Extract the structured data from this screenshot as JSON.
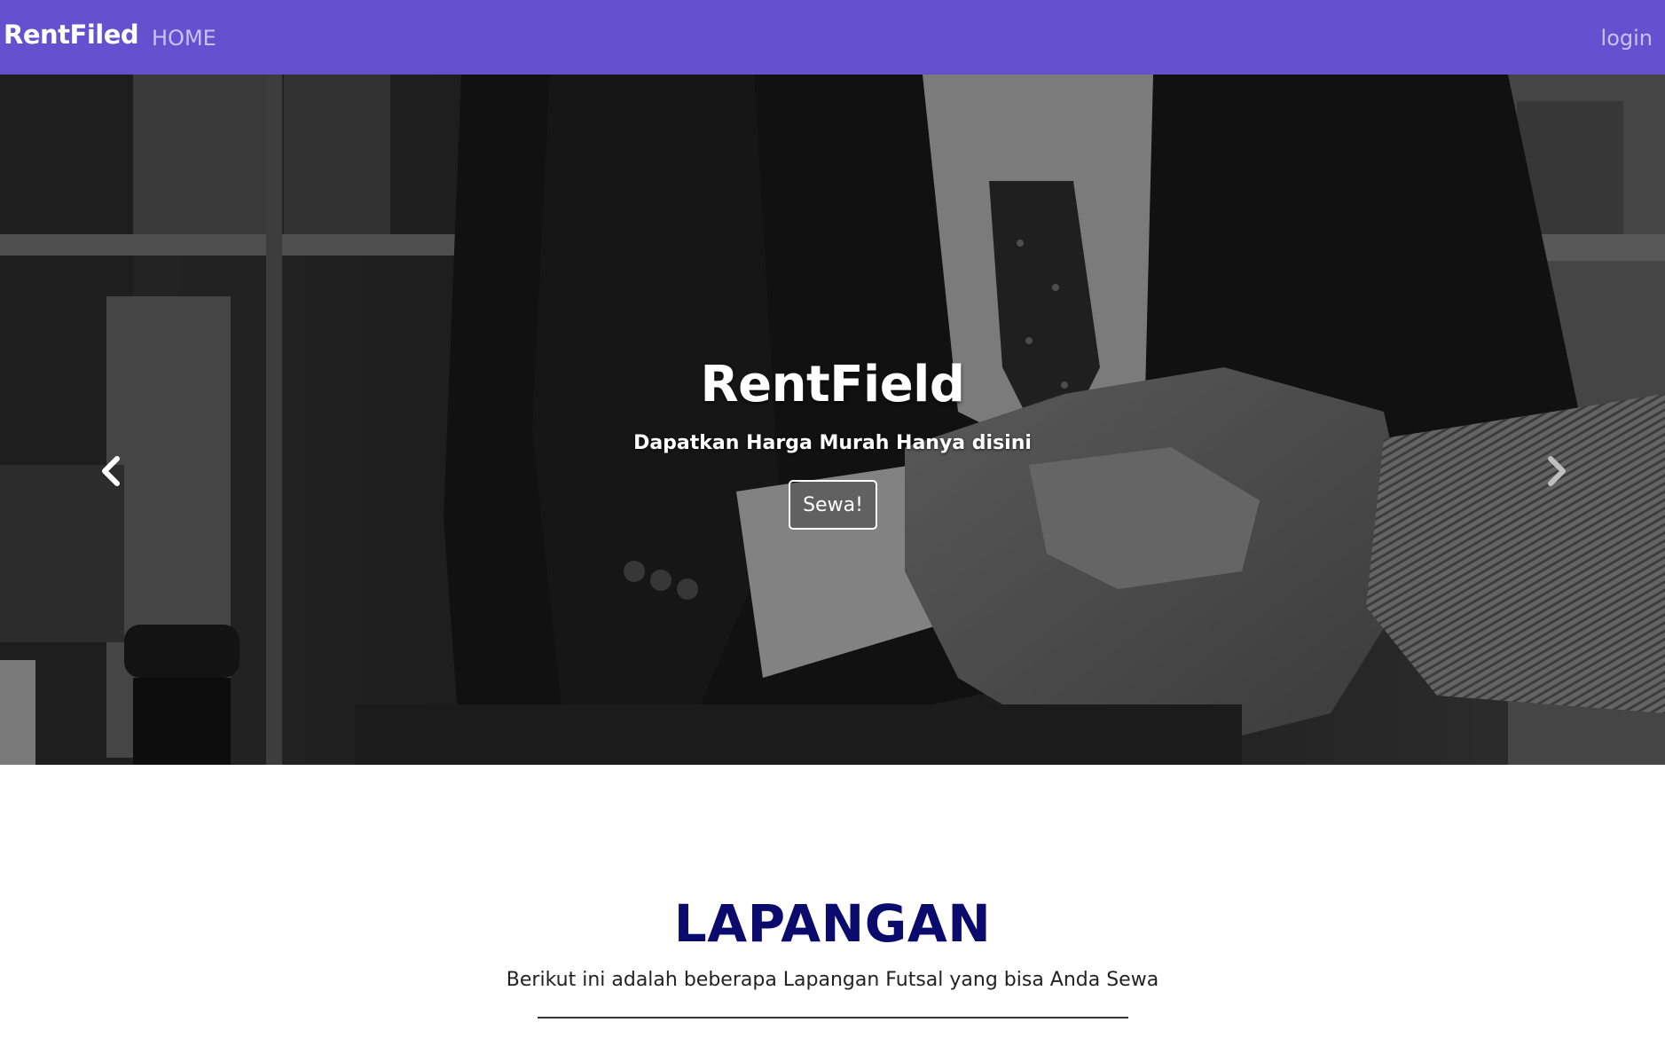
{
  "navbar": {
    "brand": "RentFiled",
    "home": "HOME",
    "login": "login",
    "background": "#6551cf"
  },
  "hero": {
    "title": "RentField",
    "subtitle": "Dapatkan Harga Murah Hanya disini",
    "button": "Sewa!",
    "image": "handshake-photo"
  },
  "section": {
    "title": "LAPANGAN",
    "subtitle": "Berikut ini adalah beberapa Lapangan Futsal yang bisa Anda Sewa",
    "title_color": "#0b0b6e"
  }
}
